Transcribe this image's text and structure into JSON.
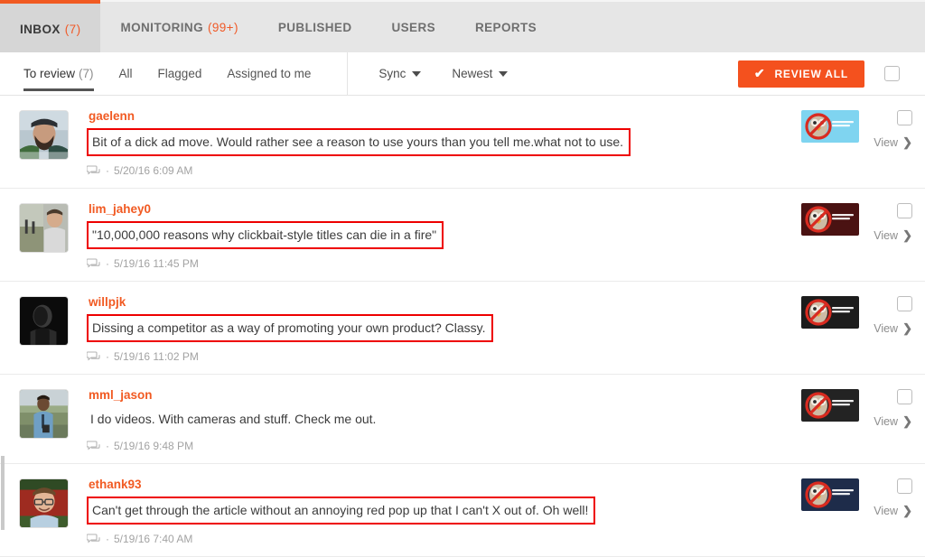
{
  "colors": {
    "accent": "#f15a22",
    "button": "#f4511e",
    "highlight_box": "#ee0000",
    "active_tab_bg": "#d6d6d6",
    "topbar_bg": "#e6e6e6"
  },
  "topbar": {
    "tabs": [
      {
        "label": "INBOX",
        "count": "(7)",
        "active": true
      },
      {
        "label": "MONITORING",
        "count": "(99+)",
        "active": false
      },
      {
        "label": "PUBLISHED",
        "count": "",
        "active": false
      },
      {
        "label": "USERS",
        "count": "",
        "active": false
      },
      {
        "label": "REPORTS",
        "count": "",
        "active": false
      }
    ]
  },
  "subbar": {
    "filters": [
      {
        "label": "To review",
        "count": "(7)",
        "active": true
      },
      {
        "label": "All",
        "count": "",
        "active": false
      },
      {
        "label": "Flagged",
        "count": "",
        "active": false
      },
      {
        "label": "Assigned to me",
        "count": "",
        "active": false
      }
    ],
    "sorts": [
      {
        "label": "Sync"
      },
      {
        "label": "Newest"
      }
    ],
    "review_all_label": "REVIEW ALL",
    "review_all_check_glyph": "✔",
    "select_all_checkbox": "unchecked"
  },
  "comments": [
    {
      "username": "gaelenn",
      "text": "Bit of a dick ad move. Would rather see a reason to use yours than you tell me.what not to use.",
      "highlighted": true,
      "timestamp": "5/20/16 6:09 AM",
      "separator": "·",
      "view_label": "View",
      "view_chevron": "❯",
      "thumb_bg": "#7fd4f0",
      "avatar_desc": "bearded-man-with-cap"
    },
    {
      "username": "lim_jahey0",
      "text": "\"10,000,000 reasons why clickbait-style titles can die in a fire\"",
      "highlighted": true,
      "timestamp": "5/19/16 11:45 PM",
      "separator": "·",
      "view_label": "View",
      "view_chevron": "❯",
      "thumb_bg": "#4a1212",
      "avatar_desc": "young-man-outdoors"
    },
    {
      "username": "willpjk",
      "text": "Dissing a competitor as a way of promoting your own product? Classy.",
      "highlighted": true,
      "timestamp": "5/19/16 11:02 PM",
      "separator": "·",
      "view_label": "View",
      "view_chevron": "❯",
      "thumb_bg": "#1c1c1c",
      "avatar_desc": "dark-silhouette-portrait"
    },
    {
      "username": "mml_jason",
      "text": "I do videos. With cameras and stuff. Check me out.",
      "highlighted": false,
      "timestamp": "5/19/16 9:48 PM",
      "separator": "·",
      "view_label": "View",
      "view_chevron": "❯",
      "thumb_bg": "#232323",
      "avatar_desc": "man-in-blue-shirt-by-water"
    },
    {
      "username": "ethank93",
      "text": "Can't get through the article without an annoying red pop up that I can't X out of. Oh well!",
      "highlighted": true,
      "timestamp": "5/19/16 7:40 AM",
      "separator": "·",
      "view_label": "View",
      "view_chevron": "❯",
      "thumb_bg": "#1e2c4a",
      "avatar_desc": "smiling-man-with-glasses-red-wall"
    }
  ]
}
